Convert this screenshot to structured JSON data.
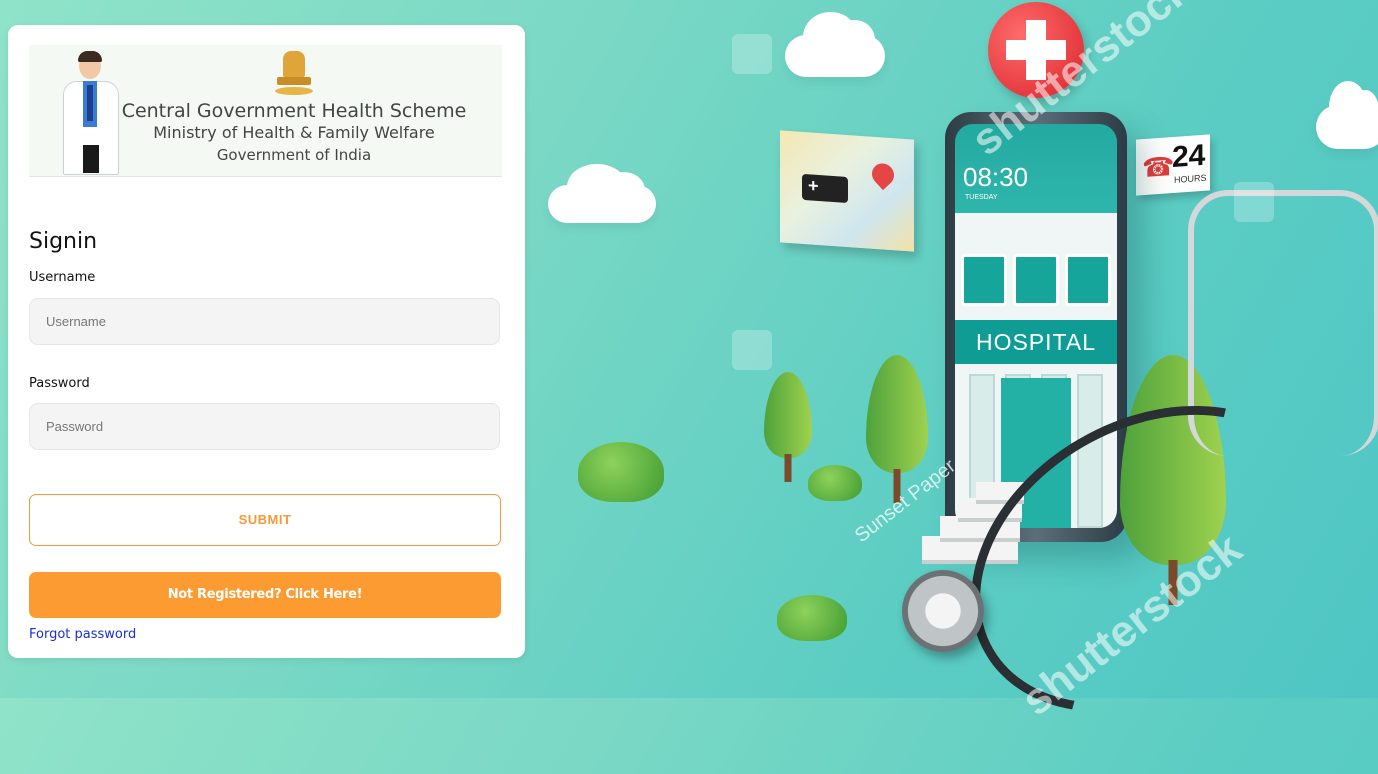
{
  "header": {
    "line1": "Central Government Health Scheme",
    "line2": "Ministry of Health & Family Welfare",
    "line3": "Government of India"
  },
  "form": {
    "title": "Signin",
    "username_label": "Username",
    "username_placeholder": "Username",
    "username_value": "",
    "password_label": "Password",
    "password_placeholder": "Password",
    "password_value": "",
    "submit_label": "SUBMIT",
    "register_label": "Not Registered? Click Here!",
    "forgot_label": "Forgot password"
  },
  "illustration": {
    "phone_time": "08:30",
    "phone_day": "TUESDAY",
    "hospital_sign": "HOSPITAL",
    "badge_number": "24",
    "badge_text": "HOURS",
    "watermark_text": "shutterstock",
    "watermark_credit": "Sunset Paper"
  },
  "colors": {
    "accent_orange": "#fd9b33",
    "link_blue": "#1a2fd1",
    "background_teal": "#5ccdc3"
  }
}
